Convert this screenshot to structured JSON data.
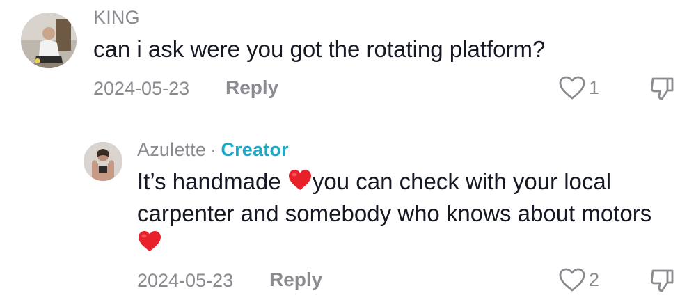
{
  "comments": [
    {
      "username": "KING",
      "text": "can i ask were you got the rotating platform?",
      "date": "2024-05-23",
      "reply_label": "Reply",
      "like_count": "1"
    },
    {
      "username": "Azulette",
      "separator": "·",
      "badge": "Creator",
      "text_line1_a": "It’s handmade ",
      "text_line1_b": "you can check with your local",
      "text_line2": "carpenter and somebody who knows about motors",
      "emoji": "❤️",
      "date": "2024-05-23",
      "reply_label": "Reply",
      "like_count": "2"
    }
  ],
  "icons": {
    "like": "heart-outline-icon",
    "dislike": "thumbs-down-icon",
    "emoji": "red-heart-emoji"
  },
  "colors": {
    "creator_badge": "#1fa7c4",
    "muted_text": "#8a8b91",
    "heart_emoji": "#e8202a"
  }
}
